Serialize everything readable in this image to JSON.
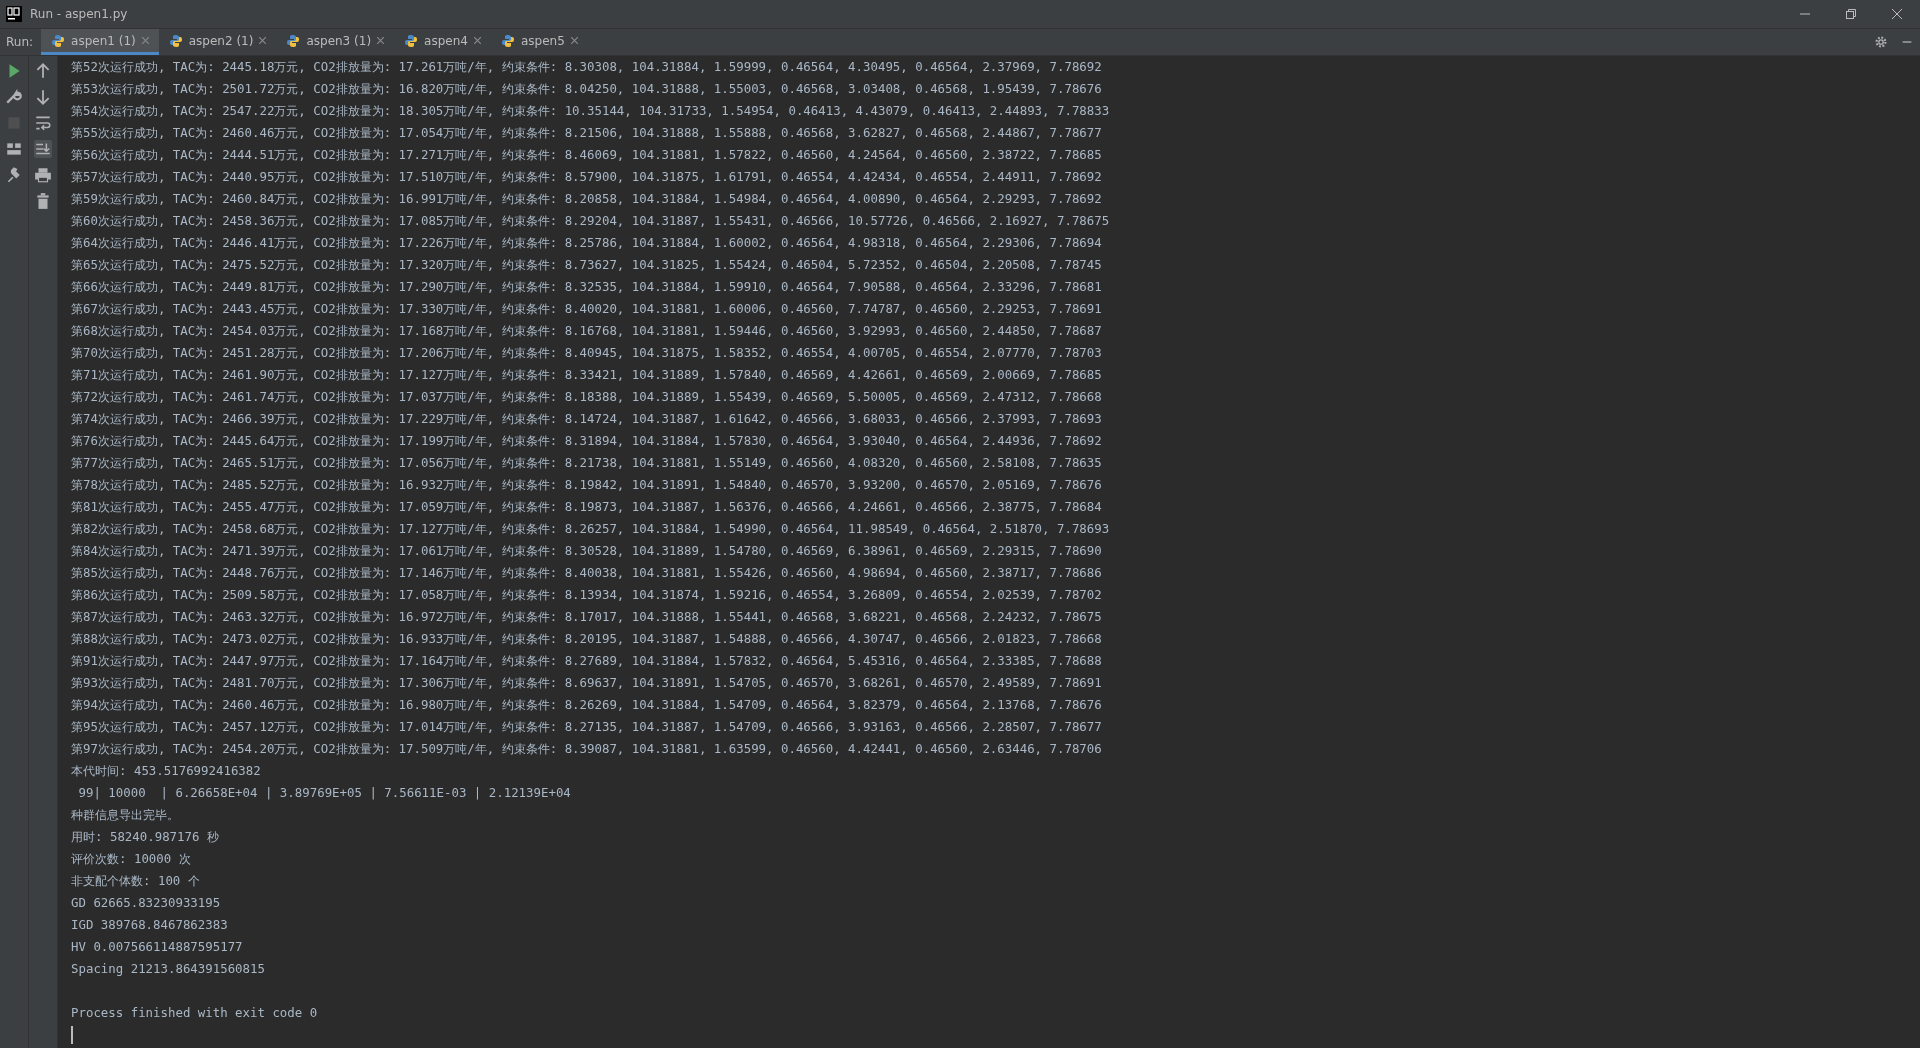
{
  "window": {
    "title": "Run - aspen1.py"
  },
  "run_panel": {
    "label": "Run:",
    "tabs": [
      {
        "label": "aspen1 (1)",
        "selected": true
      },
      {
        "label": "aspen2 (1)",
        "selected": false
      },
      {
        "label": "aspen3 (1)",
        "selected": false
      },
      {
        "label": "aspen4",
        "selected": false
      },
      {
        "label": "aspen5",
        "selected": false
      }
    ],
    "stop_disabled": true
  },
  "console": {
    "lines": [
      "第52次运行成功, TAC为: 2445.18万元, CO2排放量为: 17.261万吨/年, 约束条件: 8.30308, 104.31884, 1.59999, 0.46564, 4.30495, 0.46564, 2.37969, 7.78692",
      "第53次运行成功, TAC为: 2501.72万元, CO2排放量为: 16.820万吨/年, 约束条件: 8.04250, 104.31888, 1.55003, 0.46568, 3.03408, 0.46568, 1.95439, 7.78676",
      "第54次运行成功, TAC为: 2547.22万元, CO2排放量为: 18.305万吨/年, 约束条件: 10.35144, 104.31733, 1.54954, 0.46413, 4.43079, 0.46413, 2.44893, 7.78833",
      "第55次运行成功, TAC为: 2460.46万元, CO2排放量为: 17.054万吨/年, 约束条件: 8.21506, 104.31888, 1.55888, 0.46568, 3.62827, 0.46568, 2.44867, 7.78677",
      "第56次运行成功, TAC为: 2444.51万元, CO2排放量为: 17.271万吨/年, 约束条件: 8.46069, 104.31881, 1.57822, 0.46560, 4.24564, 0.46560, 2.38722, 7.78685",
      "第57次运行成功, TAC为: 2440.95万元, CO2排放量为: 17.510万吨/年, 约束条件: 8.57900, 104.31875, 1.61791, 0.46554, 4.42434, 0.46554, 2.44911, 7.78692",
      "第59次运行成功, TAC为: 2460.84万元, CO2排放量为: 16.991万吨/年, 约束条件: 8.20858, 104.31884, 1.54984, 0.46564, 4.00890, 0.46564, 2.29293, 7.78692",
      "第60次运行成功, TAC为: 2458.36万元, CO2排放量为: 17.085万吨/年, 约束条件: 8.29204, 104.31887, 1.55431, 0.46566, 10.57726, 0.46566, 2.16927, 7.78675",
      "第64次运行成功, TAC为: 2446.41万元, CO2排放量为: 17.226万吨/年, 约束条件: 8.25786, 104.31884, 1.60002, 0.46564, 4.98318, 0.46564, 2.29306, 7.78694",
      "第65次运行成功, TAC为: 2475.52万元, CO2排放量为: 17.320万吨/年, 约束条件: 8.73627, 104.31825, 1.55424, 0.46504, 5.72352, 0.46504, 2.20508, 7.78745",
      "第66次运行成功, TAC为: 2449.81万元, CO2排放量为: 17.290万吨/年, 约束条件: 8.32535, 104.31884, 1.59910, 0.46564, 7.90588, 0.46564, 2.33296, 7.78681",
      "第67次运行成功, TAC为: 2443.45万元, CO2排放量为: 17.330万吨/年, 约束条件: 8.40020, 104.31881, 1.60006, 0.46560, 7.74787, 0.46560, 2.29253, 7.78691",
      "第68次运行成功, TAC为: 2454.03万元, CO2排放量为: 17.168万吨/年, 约束条件: 8.16768, 104.31881, 1.59446, 0.46560, 3.92993, 0.46560, 2.44850, 7.78687",
      "第70次运行成功, TAC为: 2451.28万元, CO2排放量为: 17.206万吨/年, 约束条件: 8.40945, 104.31875, 1.58352, 0.46554, 4.00705, 0.46554, 2.07770, 7.78703",
      "第71次运行成功, TAC为: 2461.90万元, CO2排放量为: 17.127万吨/年, 约束条件: 8.33421, 104.31889, 1.57840, 0.46569, 4.42661, 0.46569, 2.00669, 7.78685",
      "第72次运行成功, TAC为: 2461.74万元, CO2排放量为: 17.037万吨/年, 约束条件: 8.18388, 104.31889, 1.55439, 0.46569, 5.50005, 0.46569, 2.47312, 7.78668",
      "第74次运行成功, TAC为: 2466.39万元, CO2排放量为: 17.229万吨/年, 约束条件: 8.14724, 104.31887, 1.61642, 0.46566, 3.68033, 0.46566, 2.37993, 7.78693",
      "第76次运行成功, TAC为: 2445.64万元, CO2排放量为: 17.199万吨/年, 约束条件: 8.31894, 104.31884, 1.57830, 0.46564, 3.93040, 0.46564, 2.44936, 7.78692",
      "第77次运行成功, TAC为: 2465.51万元, CO2排放量为: 17.056万吨/年, 约束条件: 8.21738, 104.31881, 1.55149, 0.46560, 4.08320, 0.46560, 2.58108, 7.78635",
      "第78次运行成功, TAC为: 2485.52万元, CO2排放量为: 16.932万吨/年, 约束条件: 8.19842, 104.31891, 1.54840, 0.46570, 3.93200, 0.46570, 2.05169, 7.78676",
      "第81次运行成功, TAC为: 2455.47万元, CO2排放量为: 17.059万吨/年, 约束条件: 8.19873, 104.31887, 1.56376, 0.46566, 4.24661, 0.46566, 2.38775, 7.78684",
      "第82次运行成功, TAC为: 2458.68万元, CO2排放量为: 17.127万吨/年, 约束条件: 8.26257, 104.31884, 1.54990, 0.46564, 11.98549, 0.46564, 2.51870, 7.78693",
      "第84次运行成功, TAC为: 2471.39万元, CO2排放量为: 17.061万吨/年, 约束条件: 8.30528, 104.31889, 1.54780, 0.46569, 6.38961, 0.46569, 2.29315, 7.78690",
      "第85次运行成功, TAC为: 2448.76万元, CO2排放量为: 17.146万吨/年, 约束条件: 8.40038, 104.31881, 1.55426, 0.46560, 4.98694, 0.46560, 2.38717, 7.78686",
      "第86次运行成功, TAC为: 2509.58万元, CO2排放量为: 17.058万吨/年, 约束条件: 8.13934, 104.31874, 1.59216, 0.46554, 3.26809, 0.46554, 2.02539, 7.78702",
      "第87次运行成功, TAC为: 2463.32万元, CO2排放量为: 16.972万吨/年, 约束条件: 8.17017, 104.31888, 1.55441, 0.46568, 3.68221, 0.46568, 2.24232, 7.78675",
      "第88次运行成功, TAC为: 2473.02万元, CO2排放量为: 16.933万吨/年, 约束条件: 8.20195, 104.31887, 1.54888, 0.46566, 4.30747, 0.46566, 2.01823, 7.78668",
      "第91次运行成功, TAC为: 2447.97万元, CO2排放量为: 17.164万吨/年, 约束条件: 8.27689, 104.31884, 1.57832, 0.46564, 5.45316, 0.46564, 2.33385, 7.78688",
      "第93次运行成功, TAC为: 2481.70万元, CO2排放量为: 17.306万吨/年, 约束条件: 8.69637, 104.31891, 1.54705, 0.46570, 3.68261, 0.46570, 2.49589, 7.78691",
      "第94次运行成功, TAC为: 2460.46万元, CO2排放量为: 16.980万吨/年, 约束条件: 8.26269, 104.31884, 1.54709, 0.46564, 3.82379, 0.46564, 2.13768, 7.78676",
      "第95次运行成功, TAC为: 2457.12万元, CO2排放量为: 17.014万吨/年, 约束条件: 8.27135, 104.31887, 1.54709, 0.46566, 3.93163, 0.46566, 2.28507, 7.78677",
      "第97次运行成功, TAC为: 2454.20万元, CO2排放量为: 17.509万吨/年, 约束条件: 8.39087, 104.31881, 1.63599, 0.46560, 4.42441, 0.46560, 2.63446, 7.78706",
      "本代时间: 453.5176992416382",
      " 99| 10000  | 6.26658E+04 | 3.89769E+05 | 7.56611E-03 | 2.12139E+04",
      "种群信息导出完毕。",
      "用时: 58240.987176 秒",
      "评价次数: 10000 次",
      "非支配个体数: 100 个",
      "GD 62665.83230933195",
      "IGD 389768.8467862383",
      "HV 0.007566114887595177",
      "Spacing 21213.864391560815"
    ],
    "exit_message": "Process finished with exit code 0"
  }
}
